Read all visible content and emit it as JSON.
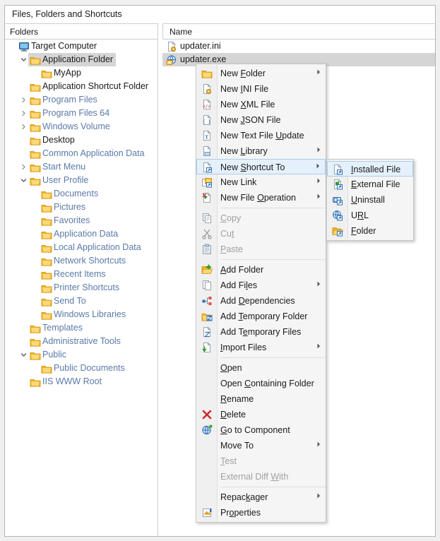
{
  "window": {
    "title": "Files, Folders and Shortcuts"
  },
  "tree": {
    "header": "Folders",
    "items": [
      {
        "label": "Target Computer",
        "indent": 0,
        "icon": "monitor-icon",
        "twisty": "none",
        "selected": false,
        "tone": "dark"
      },
      {
        "label": "Application Folder",
        "indent": 1,
        "icon": "folder-icon",
        "twisty": "expanded",
        "selected": true,
        "tone": "dark"
      },
      {
        "label": "MyApp",
        "indent": 2,
        "icon": "folder-icon",
        "twisty": "none",
        "selected": false,
        "tone": "dark"
      },
      {
        "label": "Application Shortcut Folder",
        "indent": 1,
        "icon": "folder-icon",
        "twisty": "none",
        "selected": false,
        "tone": "dark"
      },
      {
        "label": "Program Files",
        "indent": 1,
        "icon": "folder-icon",
        "twisty": "collapsed",
        "selected": false,
        "tone": "blue"
      },
      {
        "label": "Program Files 64",
        "indent": 1,
        "icon": "folder-icon",
        "twisty": "collapsed",
        "selected": false,
        "tone": "blue"
      },
      {
        "label": "Windows Volume",
        "indent": 1,
        "icon": "folder-icon",
        "twisty": "collapsed",
        "selected": false,
        "tone": "blue"
      },
      {
        "label": "Desktop",
        "indent": 1,
        "icon": "folder-icon",
        "twisty": "none",
        "selected": false,
        "tone": "dark"
      },
      {
        "label": "Common Application Data",
        "indent": 1,
        "icon": "folder-icon",
        "twisty": "none",
        "selected": false,
        "tone": "blue"
      },
      {
        "label": "Start Menu",
        "indent": 1,
        "icon": "folder-icon",
        "twisty": "collapsed",
        "selected": false,
        "tone": "blue"
      },
      {
        "label": "User Profile",
        "indent": 1,
        "icon": "folder-icon",
        "twisty": "expanded",
        "selected": false,
        "tone": "blue"
      },
      {
        "label": "Documents",
        "indent": 2,
        "icon": "folder-icon",
        "twisty": "none",
        "selected": false,
        "tone": "blue"
      },
      {
        "label": "Pictures",
        "indent": 2,
        "icon": "folder-icon",
        "twisty": "none",
        "selected": false,
        "tone": "blue"
      },
      {
        "label": "Favorites",
        "indent": 2,
        "icon": "folder-icon",
        "twisty": "none",
        "selected": false,
        "tone": "blue"
      },
      {
        "label": "Application Data",
        "indent": 2,
        "icon": "folder-icon",
        "twisty": "none",
        "selected": false,
        "tone": "blue"
      },
      {
        "label": "Local Application Data",
        "indent": 2,
        "icon": "folder-icon",
        "twisty": "none",
        "selected": false,
        "tone": "blue"
      },
      {
        "label": "Network Shortcuts",
        "indent": 2,
        "icon": "folder-icon",
        "twisty": "none",
        "selected": false,
        "tone": "blue"
      },
      {
        "label": "Recent Items",
        "indent": 2,
        "icon": "folder-icon",
        "twisty": "none",
        "selected": false,
        "tone": "blue"
      },
      {
        "label": "Printer Shortcuts",
        "indent": 2,
        "icon": "folder-icon",
        "twisty": "none",
        "selected": false,
        "tone": "blue"
      },
      {
        "label": "Send To",
        "indent": 2,
        "icon": "folder-icon",
        "twisty": "none",
        "selected": false,
        "tone": "blue"
      },
      {
        "label": "Windows Libraries",
        "indent": 2,
        "icon": "folder-icon",
        "twisty": "none",
        "selected": false,
        "tone": "blue"
      },
      {
        "label": "Templates",
        "indent": 1,
        "icon": "folder-icon",
        "twisty": "none",
        "selected": false,
        "tone": "blue"
      },
      {
        "label": "Administrative Tools",
        "indent": 1,
        "icon": "folder-icon",
        "twisty": "none",
        "selected": false,
        "tone": "blue"
      },
      {
        "label": "Public",
        "indent": 1,
        "icon": "folder-icon",
        "twisty": "expanded",
        "selected": false,
        "tone": "blue"
      },
      {
        "label": "Public Documents",
        "indent": 2,
        "icon": "folder-icon",
        "twisty": "none",
        "selected": false,
        "tone": "blue"
      },
      {
        "label": "IIS WWW Root",
        "indent": 1,
        "icon": "folder-icon",
        "twisty": "none",
        "selected": false,
        "tone": "blue"
      }
    ]
  },
  "list": {
    "header": "Name",
    "rows": [
      {
        "name": "updater.ini",
        "icon": "ini-file-icon",
        "selected": false
      },
      {
        "name": "updater.exe",
        "icon": "exe-file-icon",
        "selected": true
      }
    ]
  },
  "context_menu": {
    "items": [
      {
        "label": "New Folder",
        "accel": "F",
        "icon": "folder-icon",
        "submenu": true,
        "disabled": false,
        "highlighted": false
      },
      {
        "label": "New INI File",
        "accel": "I",
        "icon": "ini-file-icon",
        "submenu": false,
        "disabled": false,
        "highlighted": false
      },
      {
        "label": "New XML File",
        "accel": "X",
        "icon": "xml-file-icon",
        "submenu": false,
        "disabled": false,
        "highlighted": false
      },
      {
        "label": "New JSON File",
        "accel": "J",
        "icon": "json-file-icon",
        "submenu": false,
        "disabled": false,
        "highlighted": false
      },
      {
        "label": "New Text File Update",
        "accel": "U",
        "icon": "text-file-icon",
        "submenu": false,
        "disabled": false,
        "highlighted": false
      },
      {
        "label": "New Library",
        "accel": "L",
        "icon": "library-icon",
        "submenu": true,
        "disabled": false,
        "highlighted": false
      },
      {
        "label": "New Shortcut To",
        "accel": "S",
        "icon": "shortcut-icon",
        "submenu": true,
        "disabled": false,
        "highlighted": true
      },
      {
        "label": "New Link",
        "accel": "",
        "icon": "link-icon",
        "submenu": true,
        "disabled": false,
        "highlighted": false
      },
      {
        "label": "New File Operation",
        "accel": "O",
        "icon": "file-operation-icon",
        "submenu": true,
        "disabled": false,
        "highlighted": false
      },
      {
        "separator": true
      },
      {
        "label": "Copy",
        "accel": "C",
        "icon": "copy-icon",
        "submenu": false,
        "disabled": true,
        "highlighted": false
      },
      {
        "label": "Cut",
        "accel": "t",
        "icon": "cut-icon",
        "submenu": false,
        "disabled": true,
        "highlighted": false
      },
      {
        "label": "Paste",
        "accel": "P",
        "icon": "paste-icon",
        "submenu": false,
        "disabled": true,
        "highlighted": false
      },
      {
        "separator": true
      },
      {
        "label": "Add Folder",
        "accel": "A",
        "icon": "add-folder-icon",
        "submenu": false,
        "disabled": false,
        "highlighted": false
      },
      {
        "label": "Add Files",
        "accel": "l",
        "icon": "add-files-icon",
        "submenu": true,
        "disabled": false,
        "highlighted": false
      },
      {
        "label": "Add Dependencies",
        "accel": "D",
        "icon": "dependencies-icon",
        "submenu": false,
        "disabled": false,
        "highlighted": false
      },
      {
        "label": "Add Temporary Folder",
        "accel": "T",
        "icon": "temp-folder-icon",
        "submenu": false,
        "disabled": false,
        "highlighted": false
      },
      {
        "label": "Add Temporary Files",
        "accel": "e",
        "icon": "temp-files-icon",
        "submenu": false,
        "disabled": false,
        "highlighted": false
      },
      {
        "label": "Import Files",
        "accel": "I",
        "icon": "import-icon",
        "submenu": true,
        "disabled": false,
        "highlighted": false
      },
      {
        "separator": true
      },
      {
        "label": "Open",
        "accel": "O",
        "icon": "none",
        "submenu": false,
        "disabled": false,
        "highlighted": false
      },
      {
        "label": "Open Containing Folder",
        "accel": "C",
        "icon": "none",
        "submenu": false,
        "disabled": false,
        "highlighted": false
      },
      {
        "label": "Rename",
        "accel": "R",
        "icon": "none",
        "submenu": false,
        "disabled": false,
        "highlighted": false
      },
      {
        "label": "Delete",
        "accel": "D",
        "icon": "delete-icon",
        "submenu": false,
        "disabled": false,
        "highlighted": false
      },
      {
        "label": "Go to Component",
        "accel": "G",
        "icon": "component-icon",
        "submenu": false,
        "disabled": false,
        "highlighted": false
      },
      {
        "label": "Move To",
        "accel": "",
        "icon": "none",
        "submenu": true,
        "disabled": false,
        "highlighted": false
      },
      {
        "label": "Test",
        "accel": "T",
        "icon": "none",
        "submenu": false,
        "disabled": true,
        "highlighted": false
      },
      {
        "label": "External Diff With",
        "accel": "W",
        "icon": "none",
        "submenu": false,
        "disabled": true,
        "highlighted": false
      },
      {
        "separator": true
      },
      {
        "label": "Repackager",
        "accel": "k",
        "icon": "none",
        "submenu": true,
        "disabled": false,
        "highlighted": false
      },
      {
        "label": "Properties",
        "accel": "o",
        "icon": "properties-icon",
        "submenu": false,
        "disabled": false,
        "highlighted": false
      }
    ]
  },
  "sub_menu": {
    "items": [
      {
        "label": "Installed File",
        "accel": "I",
        "icon": "installed-file-icon",
        "disabled": false,
        "highlighted": true
      },
      {
        "label": "External File",
        "accel": "E",
        "icon": "external-file-icon",
        "disabled": false,
        "highlighted": false
      },
      {
        "label": "Uninstall",
        "accel": "U",
        "icon": "uninstall-icon",
        "disabled": false,
        "highlighted": false
      },
      {
        "label": "URL",
        "accel": "R",
        "icon": "url-icon",
        "disabled": false,
        "highlighted": false
      },
      {
        "label": "Folder",
        "accel": "F",
        "icon": "folder-shortcut-icon",
        "disabled": false,
        "highlighted": false
      }
    ]
  },
  "colors": {
    "selection": "#d5d5d5",
    "highlight": "#e4f0fb",
    "highlight_border": "#aecbe8",
    "folder": "#f2b632",
    "tree_blue_text": "#5a7aa8",
    "menu_bg": "#f5f5f5"
  }
}
